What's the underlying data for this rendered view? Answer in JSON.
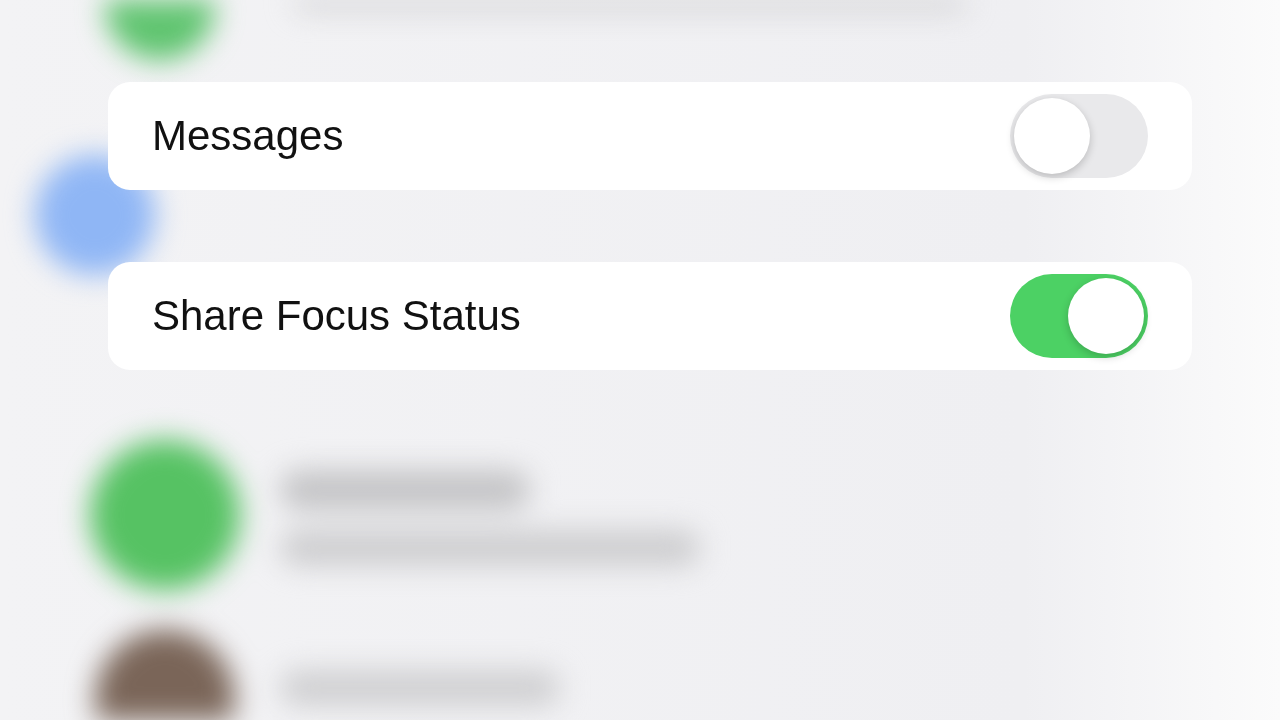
{
  "rows": [
    {
      "label": "Messages",
      "on": false
    },
    {
      "label": "Share Focus Status",
      "on": true
    }
  ]
}
